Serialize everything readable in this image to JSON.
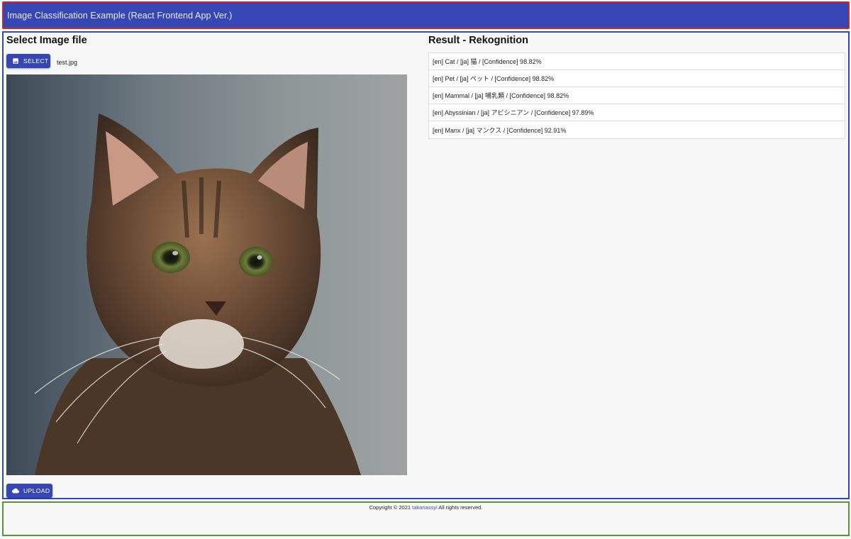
{
  "header": {
    "title": "Image Classification Example (React Frontend App Ver.)"
  },
  "select_section": {
    "title": "Select Image file",
    "select_button_label": "SELECT",
    "select_button_icon": "image-icon",
    "file_name": "test.jpg",
    "upload_button_label": "UPLOAD",
    "upload_button_icon": "cloud-icon"
  },
  "result_section": {
    "title": "Result - Rekognition",
    "items": [
      "[en] Cat / [ja] 猫 / [Confidence] 98.82%",
      "[en] Pet / [ja] ペット / [Confidence] 98.82%",
      "[en] Mammal / [ja] 哺乳類 / [Confidence] 98.82%",
      "[en] Abyssinian / [ja] アビシニアン / [Confidence] 97.89%",
      "[en] Manx / [ja] マンクス / [Confidence] 92.91%"
    ]
  },
  "footer": {
    "prefix": "Copyright © 2021",
    "link_text": "takanassyi",
    "suffix": "All rights reserved."
  },
  "colors": {
    "primary": "#3647b5",
    "header_outline": "#d32626",
    "main_outline": "#2d4bb7",
    "footer_outline": "#4f9a32"
  }
}
